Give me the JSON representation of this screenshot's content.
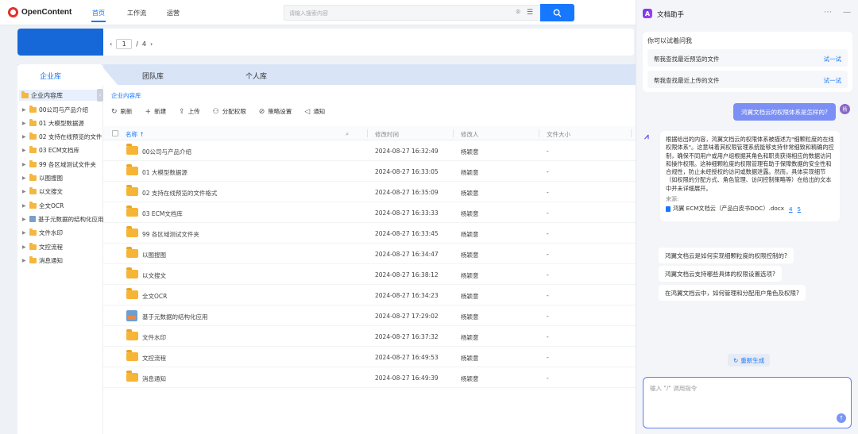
{
  "app": {
    "logo_text": "OpenContent"
  },
  "nav": {
    "tabs": [
      "首页",
      "工作流",
      "运营"
    ],
    "active_index": 0
  },
  "search": {
    "placeholder": "请输入搜索内容"
  },
  "pager": {
    "current": "1",
    "separator": "/",
    "total": "4"
  },
  "library_tabs": [
    "企业库",
    "团队库",
    "个人库"
  ],
  "tree": {
    "root": "企业内容库",
    "items": [
      {
        "label": "00公司与产品介绍",
        "kind": "folder"
      },
      {
        "label": "01 大模型数据源",
        "kind": "folder"
      },
      {
        "label": "02 支持在线预览的文件",
        "kind": "folder"
      },
      {
        "label": "03 ECM文档库",
        "kind": "folder"
      },
      {
        "label": "99 各区域测试文件夹",
        "kind": "folder"
      },
      {
        "label": "以图搜图",
        "kind": "folder"
      },
      {
        "label": "以文搜文",
        "kind": "folder"
      },
      {
        "label": "全文OCR",
        "kind": "folder"
      },
      {
        "label": "基于元数据的结构化应用",
        "kind": "image"
      },
      {
        "label": "文件水印",
        "kind": "folder"
      },
      {
        "label": "文控流程",
        "kind": "folder"
      },
      {
        "label": "消息通知",
        "kind": "folder"
      }
    ]
  },
  "breadcrumb": "企业内容库",
  "toolbar": [
    "刷新",
    "新建",
    "上传",
    "分配权限",
    "策略设置",
    "通知"
  ],
  "table": {
    "headers": {
      "name": "名称 ↑",
      "modified": "修改时间",
      "modifier": "修改人",
      "size": "文件大小"
    },
    "rows": [
      {
        "name": "00公司与产品介绍",
        "time": "2024-08-27 16:32:49",
        "user": "杨颖意",
        "size": "-",
        "kind": "folder"
      },
      {
        "name": "01 大模型数据源",
        "time": "2024-08-27 16:33:05",
        "user": "杨颖意",
        "size": "-",
        "kind": "folder"
      },
      {
        "name": "02 支持在线预览的文件格式",
        "time": "2024-08-27 16:35:09",
        "user": "杨颖意",
        "size": "-",
        "kind": "folder"
      },
      {
        "name": "03 ECM文档库",
        "time": "2024-08-27 16:33:33",
        "user": "杨颖意",
        "size": "-",
        "kind": "folder"
      },
      {
        "name": "99 各区域测试文件夹",
        "time": "2024-08-27 16:33:45",
        "user": "杨颖意",
        "size": "-",
        "kind": "folder"
      },
      {
        "name": "以图搜图",
        "time": "2024-08-27 16:34:47",
        "user": "杨颖意",
        "size": "-",
        "kind": "folder"
      },
      {
        "name": "以文搜文",
        "time": "2024-08-27 16:38:12",
        "user": "杨颖意",
        "size": "-",
        "kind": "folder"
      },
      {
        "name": "全文OCR",
        "time": "2024-08-27 16:34:23",
        "user": "杨颖意",
        "size": "-",
        "kind": "folder"
      },
      {
        "name": "基于元数据的结构化应用",
        "time": "2024-08-27 17:29:02",
        "user": "杨颖意",
        "size": "-",
        "kind": "image"
      },
      {
        "name": "文件水印",
        "time": "2024-08-27 16:37:32",
        "user": "杨颖意",
        "size": "-",
        "kind": "folder"
      },
      {
        "name": "文控流程",
        "time": "2024-08-27 16:49:53",
        "user": "杨颖意",
        "size": "-",
        "kind": "folder"
      },
      {
        "name": "消息通知",
        "time": "2024-08-27 16:49:39",
        "user": "杨颖意",
        "size": "-",
        "kind": "folder"
      }
    ]
  },
  "assistant": {
    "title": "文档助手",
    "try_label": "你可以试着问我",
    "try_items": [
      {
        "question": "帮我查找最近预览的文件",
        "action": "试一试"
      },
      {
        "question": "帮我查找最近上传的文件",
        "action": "试一试"
      }
    ],
    "user_message": "鸿翼文档云的权限体系是怎样的?",
    "user_avatar": "杨",
    "bot_answer": "根据给出的内容，鸿翼文档云的权限体系被描述为\"细颗粒度的在线权限体系\"。这意味着其权限管理系统能够支持非常细致和精确的控制，确保不同用户或用户组根据其角色和职责获得相应的数据访问和操作权限。这种细颗粒度的权限管理有助于保障数据的安全性和合规性，防止未经授权的访问或数据泄露。然而，具体实现细节（如权限的分配方式、角色管理、访问控制策略等）在给出的文本中并未详细展开。",
    "source_label": "来源:",
    "source_doc": "鸿翼 ECM文档云（产品白皮书DOC）.docx",
    "source_refs": [
      "4",
      "5"
    ],
    "suggestions": [
      "鸿翼文档云是如何实现细颗粒度的权限控制的?",
      "鸿翼文档云支持哪些具体的权限设置选项?",
      "在鸿翼文档云中，如何管理和分配用户角色及权限?"
    ],
    "regenerate": "重新生成",
    "input_placeholder": "输入 \"/\" 调用指令"
  },
  "colors": {
    "accent": "#1677ff",
    "banner": "#1668d8",
    "folder": "#f6b537",
    "user_bubble": "#7b8ff4"
  }
}
